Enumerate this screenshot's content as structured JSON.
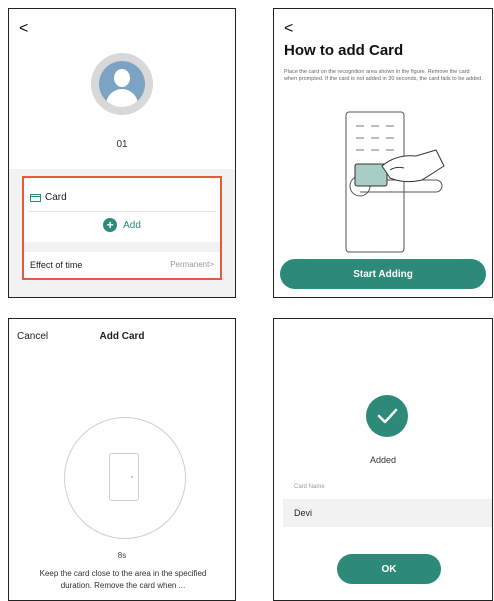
{
  "colors": {
    "accent": "#2d8a78",
    "highlight": "#e35a3f"
  },
  "screen1": {
    "back_icon": "chevron-left-icon",
    "back_glyph": "<",
    "user_name": "01",
    "card_label": "Card",
    "add_label": "Add",
    "add_glyph": "+",
    "effect_label": "Effect of time",
    "effect_value": "Permanent>"
  },
  "screen2": {
    "back_glyph": "<",
    "title": "How to add Card",
    "description": "Place the card on the recognition area shown in the figure. Remove the card when prompted. If the card is not added in 30 seconds, the card fails to be added.",
    "button": "Start Adding"
  },
  "screen3": {
    "cancel": "Cancel",
    "title": "Add Card",
    "timer": "8s",
    "instruction": "Keep the card close to the area in the specified duration. Remove the card when ..."
  },
  "screen4": {
    "status": "Added",
    "name_label": "Card Name",
    "name_value": "Devi",
    "ok": "OK"
  }
}
